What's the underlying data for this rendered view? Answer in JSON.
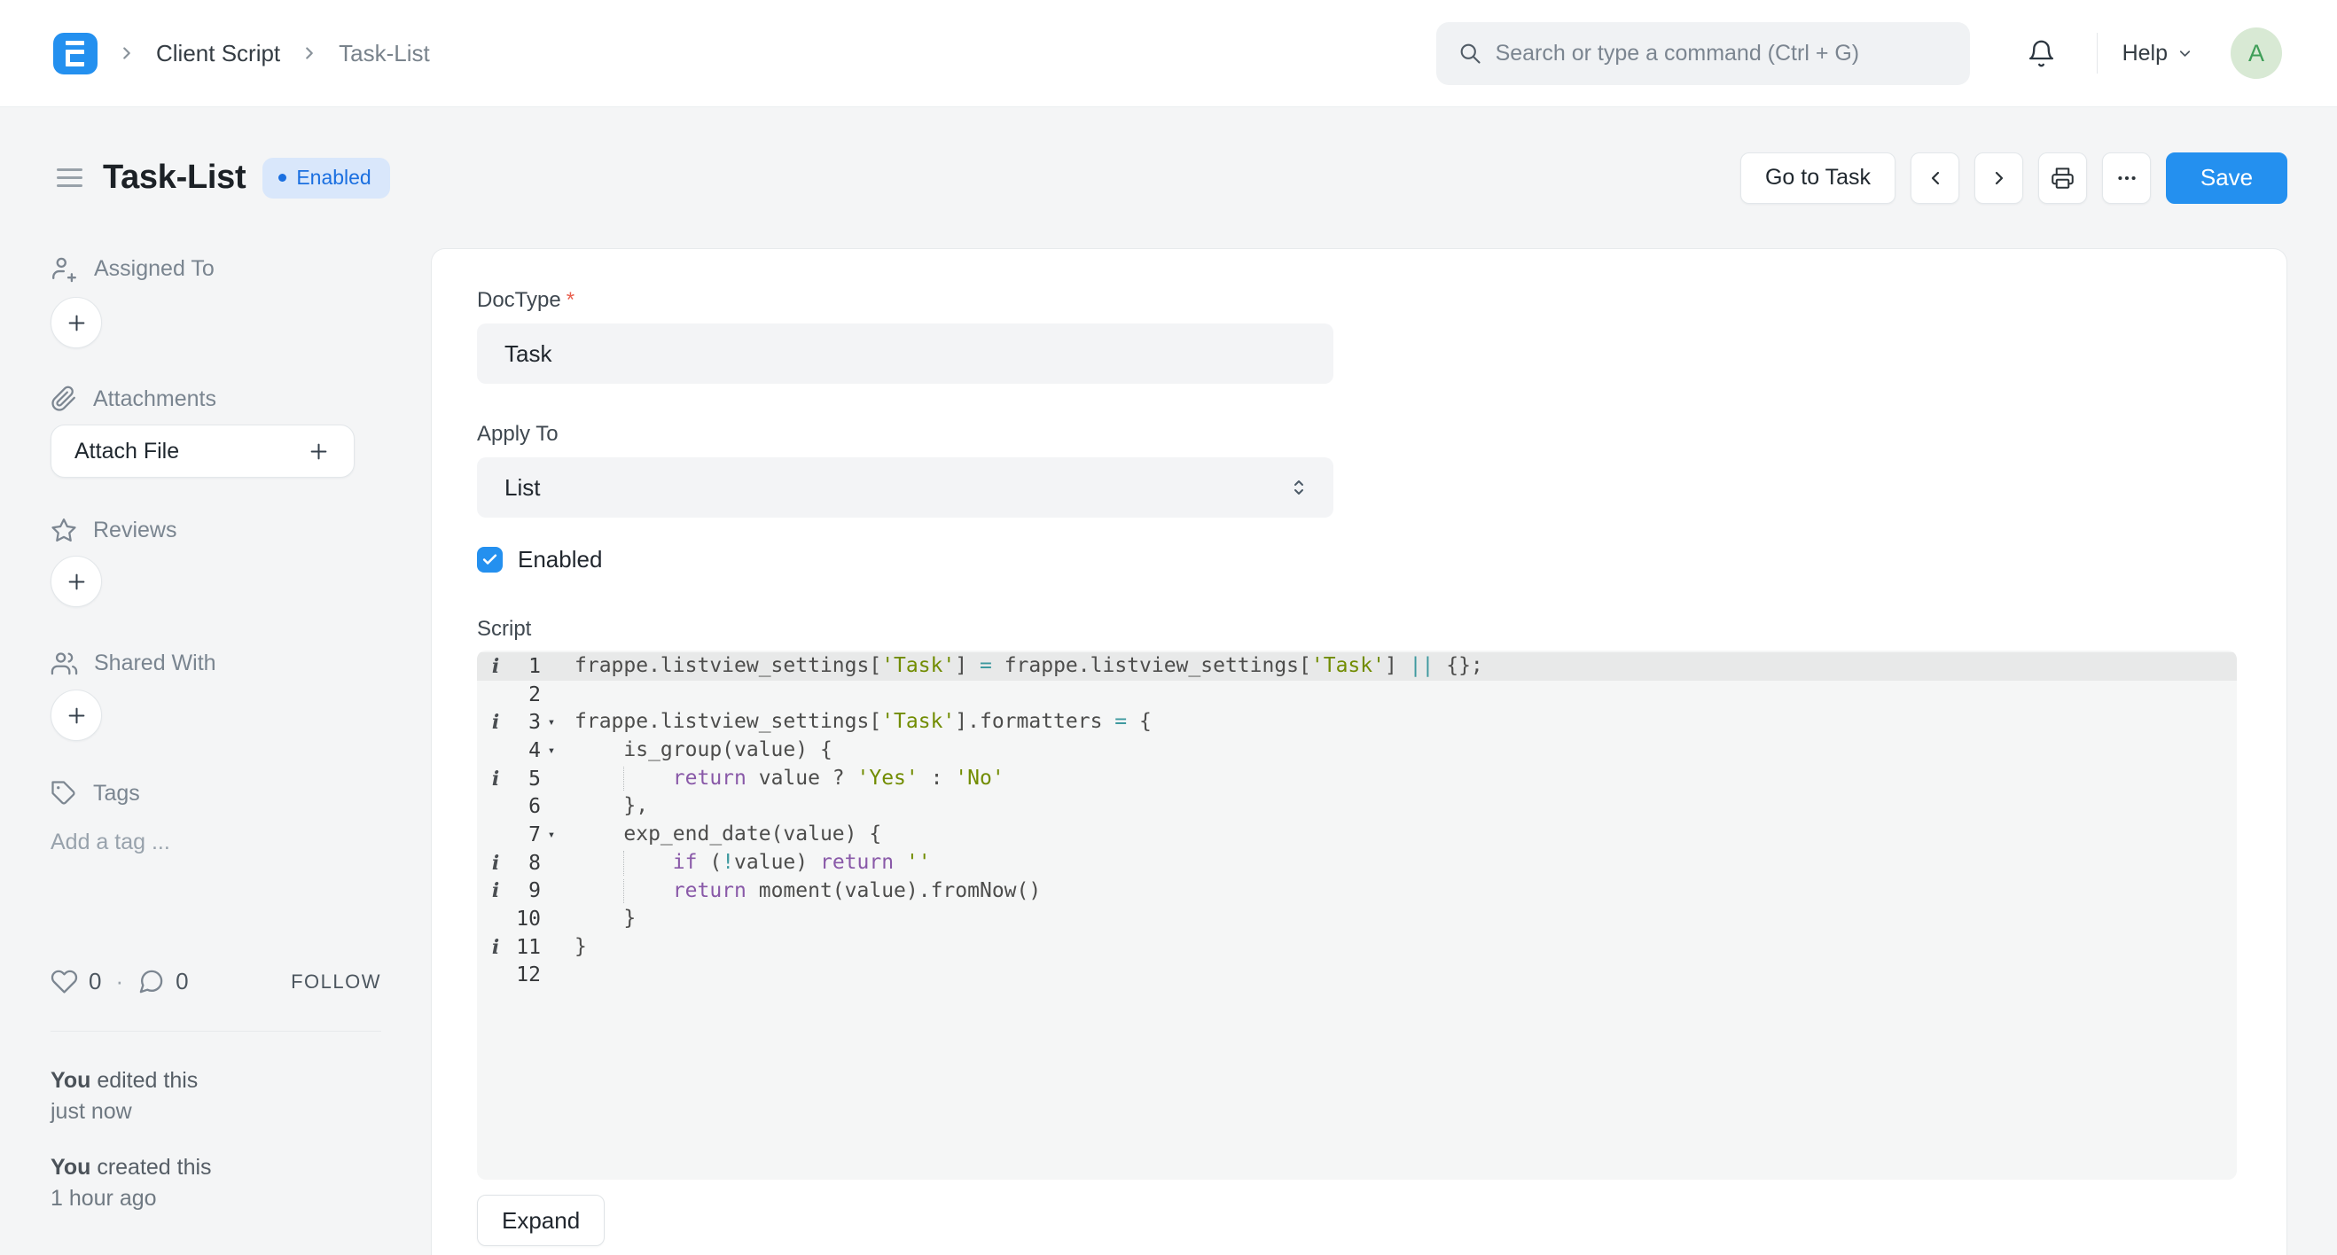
{
  "navbar": {
    "breadcrumb": {
      "parent": "Client Script",
      "current": "Task-List"
    },
    "search_placeholder": "Search or type a command (Ctrl + G)",
    "help_label": "Help",
    "avatar_letter": "A"
  },
  "header": {
    "title": "Task-List",
    "badge_label": "Enabled",
    "go_to_task_label": "Go to Task",
    "save_label": "Save"
  },
  "sidebar": {
    "sections": [
      {
        "label": "Assigned To"
      },
      {
        "label": "Attachments"
      },
      {
        "label": "Reviews"
      },
      {
        "label": "Shared With"
      },
      {
        "label": "Tags"
      }
    ],
    "attach_button_label": "Attach File",
    "tags_placeholder": "Add a tag ...",
    "likes_count": "0",
    "likes_separator": "·",
    "comments_count": "0",
    "follow_label": "FOLLOW",
    "activity": [
      {
        "actor": "You",
        "action": " edited this",
        "when": "just now"
      },
      {
        "actor": "You",
        "action": " created this",
        "when": "1 hour ago"
      }
    ]
  },
  "form": {
    "doctype_label": "DocType",
    "required_marker": "*",
    "doctype_value": "Task",
    "apply_to_label": "Apply To",
    "apply_to_value": "List",
    "enabled_label": "Enabled",
    "enabled_checked": true,
    "script_label": "Script",
    "expand_label": "Expand"
  },
  "editor": {
    "lines": [
      {
        "no": 1,
        "ann": true,
        "fold": false,
        "active": true,
        "guide": false,
        "tokens": [
          [
            "d",
            "frappe.listview_settings["
          ],
          [
            "s",
            "'Task'"
          ],
          [
            "d",
            "] "
          ],
          [
            "o",
            "="
          ],
          [
            "d",
            " frappe.listview_settings["
          ],
          [
            "s",
            "'Task'"
          ],
          [
            "d",
            "] "
          ],
          [
            "o",
            "||"
          ],
          [
            "d",
            " {};"
          ]
        ]
      },
      {
        "no": 2,
        "ann": false,
        "fold": false,
        "active": false,
        "guide": false,
        "tokens": []
      },
      {
        "no": 3,
        "ann": true,
        "fold": true,
        "active": false,
        "guide": false,
        "tokens": [
          [
            "d",
            "frappe.listview_settings["
          ],
          [
            "s",
            "'Task'"
          ],
          [
            "d",
            "].formatters "
          ],
          [
            "o",
            "="
          ],
          [
            "d",
            " {"
          ]
        ]
      },
      {
        "no": 4,
        "ann": false,
        "fold": true,
        "active": false,
        "guide": false,
        "tokens": [
          [
            "d",
            "    is_group(value) {"
          ]
        ]
      },
      {
        "no": 5,
        "ann": true,
        "fold": false,
        "active": false,
        "guide": true,
        "tokens": [
          [
            "d",
            "        "
          ],
          [
            "k",
            "return"
          ],
          [
            "d",
            " value ? "
          ],
          [
            "s",
            "'Yes'"
          ],
          [
            "d",
            " : "
          ],
          [
            "s",
            "'No'"
          ]
        ]
      },
      {
        "no": 6,
        "ann": false,
        "fold": false,
        "active": false,
        "guide": false,
        "tokens": [
          [
            "d",
            "    },"
          ]
        ]
      },
      {
        "no": 7,
        "ann": false,
        "fold": true,
        "active": false,
        "guide": false,
        "tokens": [
          [
            "d",
            "    exp_end_date(value) {"
          ]
        ]
      },
      {
        "no": 8,
        "ann": true,
        "fold": false,
        "active": false,
        "guide": true,
        "tokens": [
          [
            "d",
            "        "
          ],
          [
            "k",
            "if"
          ],
          [
            "d",
            " ("
          ],
          [
            "o",
            "!"
          ],
          [
            "d",
            "value) "
          ],
          [
            "k",
            "return"
          ],
          [
            "d",
            " "
          ],
          [
            "s",
            "''"
          ]
        ]
      },
      {
        "no": 9,
        "ann": true,
        "fold": false,
        "active": false,
        "guide": true,
        "tokens": [
          [
            "d",
            "        "
          ],
          [
            "k",
            "return"
          ],
          [
            "d",
            " moment(value).fromNow()"
          ]
        ]
      },
      {
        "no": 10,
        "ann": false,
        "fold": false,
        "active": false,
        "guide": false,
        "tokens": [
          [
            "d",
            "    }"
          ]
        ]
      },
      {
        "no": 11,
        "ann": true,
        "fold": false,
        "active": false,
        "guide": false,
        "tokens": [
          [
            "d",
            "}"
          ]
        ]
      },
      {
        "no": 12,
        "ann": false,
        "fold": false,
        "active": false,
        "guide": false,
        "tokens": []
      }
    ]
  },
  "colors": {
    "accent_blue": "#2490ef",
    "badge_bg": "#d9e7fb",
    "badge_text": "#1a6fe0",
    "required_red": "#e8604f",
    "avatar_bg": "#d8e9d4",
    "avatar_text": "#3f9e58",
    "code_string": "#718c00",
    "code_keyword": "#8959a8",
    "code_operator": "#3e999f",
    "code_default": "#4d4d4c"
  }
}
